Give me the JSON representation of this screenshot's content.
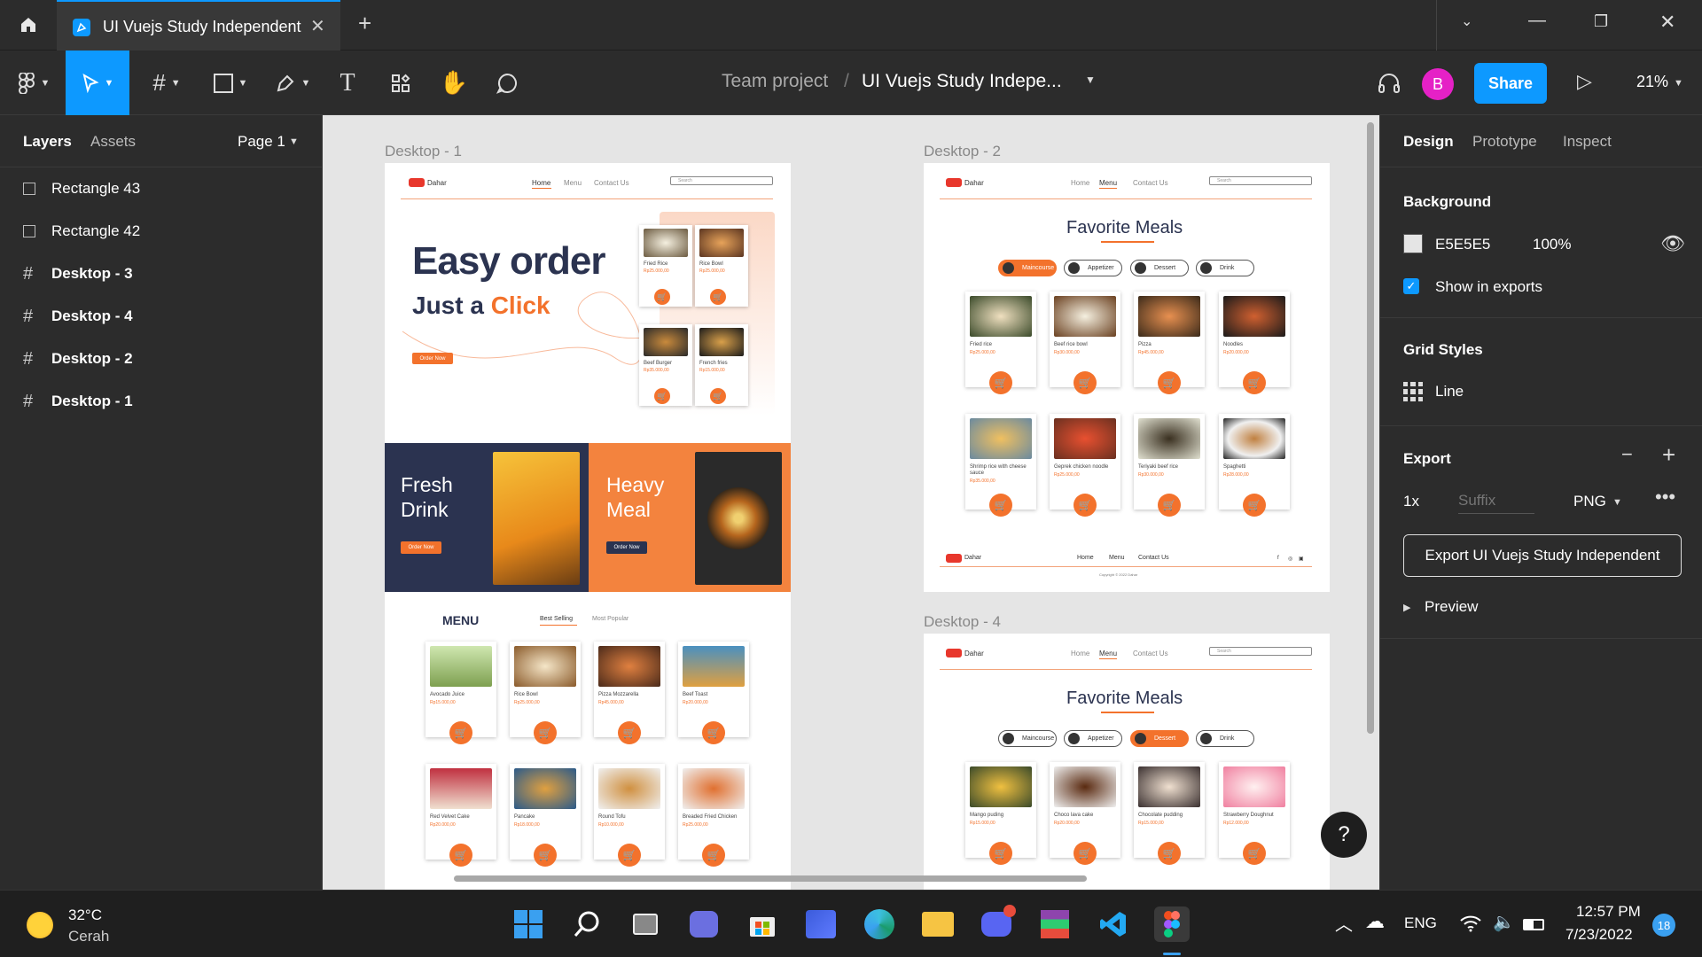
{
  "window": {
    "tab_title": "UI Vuejs Study Independent"
  },
  "toolbar": {
    "breadcrumb_team": "Team project",
    "breadcrumb_sep": "/",
    "file_name": "UI Vuejs Study Indepe...",
    "avatar": "B",
    "share": "Share",
    "zoom": "21%"
  },
  "left_panel": {
    "tab_layers": "Layers",
    "tab_assets": "Assets",
    "page": "Page 1",
    "layers": [
      {
        "name": "Rectangle 43",
        "icon": "rectangle-icon"
      },
      {
        "name": "Rectangle 42",
        "icon": "rectangle-icon"
      },
      {
        "name": "Desktop - 3",
        "icon": "frame-icon"
      },
      {
        "name": "Desktop - 4",
        "icon": "frame-icon"
      },
      {
        "name": "Desktop - 2",
        "icon": "frame-icon"
      },
      {
        "name": "Desktop - 1",
        "icon": "frame-icon"
      }
    ]
  },
  "canvas": {
    "frame_labels": {
      "d1": "Desktop - 1",
      "d2": "Desktop - 2",
      "d4": "Desktop - 4"
    },
    "brand": "Dahar",
    "nav": {
      "home": "Home",
      "menu": "Menu",
      "contact": "Contact Us",
      "search": "Search"
    },
    "hero": {
      "line1": "Easy order",
      "line2a": "Just a ",
      "line2b": "Click",
      "cta": "Order Now",
      "items": [
        {
          "name": "Fried Rice",
          "price": "Rp25.000,00"
        },
        {
          "name": "Rice Bowl",
          "price": "Rp25.000,00"
        },
        {
          "name": "Beef Burger",
          "price": "Rp35.000,00"
        },
        {
          "name": "French fries",
          "price": "Rp15.000,00"
        }
      ]
    },
    "promo": {
      "drink1": "Fresh",
      "drink2": "Drink",
      "meal1": "Heavy",
      "meal2": "Meal",
      "cta": "Order Now"
    },
    "menu_section": {
      "title": "MENU",
      "tab_best": "Best Selling",
      "tab_popular": "Most Popular",
      "items": [
        {
          "name": "Avocado Juice",
          "price": "Rp15.000,00"
        },
        {
          "name": "Rice Bowl",
          "price": "Rp25.000,00"
        },
        {
          "name": "Pizza Mozzarella",
          "price": "Rp45.000,00"
        },
        {
          "name": "Beef Toast",
          "price": "Rp20.000,00"
        },
        {
          "name": "Red Velvet Cake",
          "price": "Rp20.000,00"
        },
        {
          "name": "Pancake",
          "price": "Rp18.000,00"
        },
        {
          "name": "Round Tofu",
          "price": "Rp10.000,00"
        },
        {
          "name": "Breaded Fried Chicken",
          "price": "Rp25.000,00"
        }
      ]
    },
    "fav": {
      "title": "Favorite Meals",
      "pills": [
        "Maincourse",
        "Appetizer",
        "Dessert",
        "Drink"
      ],
      "d2_items": [
        {
          "name": "Fried rice",
          "price": "Rp25.000,00"
        },
        {
          "name": "Beef rice bowl",
          "price": "Rp30.000,00"
        },
        {
          "name": "Pizza",
          "price": "Rp45.000,00"
        },
        {
          "name": "Noodles",
          "price": "Rp20.000,00"
        },
        {
          "name": "Shrimp rice with cheese sauce",
          "price": "Rp35.000,00"
        },
        {
          "name": "Geprek chicken noodle",
          "price": "Rp25.000,00"
        },
        {
          "name": "Teriyaki beef rice",
          "price": "Rp30.000,00"
        },
        {
          "name": "Spaghetti",
          "price": "Rp28.000,00"
        }
      ],
      "d4_items": [
        {
          "name": "Mango puding",
          "price": "Rp15.000,00"
        },
        {
          "name": "Choco lava cake",
          "price": "Rp20.000,00"
        },
        {
          "name": "Chocolate pudding",
          "price": "Rp15.000,00"
        },
        {
          "name": "Strawberry Doughnut",
          "price": "Rp12.000,00"
        }
      ],
      "footer_links": [
        "Home",
        "Menu",
        "Contact Us"
      ],
      "copyright": "Copyright © 2022 Dahar"
    }
  },
  "right_panel": {
    "tab_design": "Design",
    "tab_prototype": "Prototype",
    "tab_inspect": "Inspect",
    "background_title": "Background",
    "bg_hex": "E5E5E5",
    "bg_opacity": "100%",
    "show_exports": "Show in exports",
    "grid_title": "Grid Styles",
    "grid_line": "Line",
    "export_title": "Export",
    "scale": "1x",
    "suffix_placeholder": "Suffix",
    "format": "PNG",
    "export_button": "Export UI Vuejs Study Independent",
    "preview": "Preview",
    "help": "?"
  },
  "taskbar": {
    "temp": "32°C",
    "weather": "Cerah",
    "lang": "ENG",
    "time": "12:57 PM",
    "date": "7/23/2022",
    "notif": "18"
  },
  "colors": {
    "accent": "#f3722c",
    "figma_blue": "#0d99ff",
    "navy": "#2b3350",
    "canvas": "#e5e5e5",
    "panel": "#2c2c2c"
  }
}
